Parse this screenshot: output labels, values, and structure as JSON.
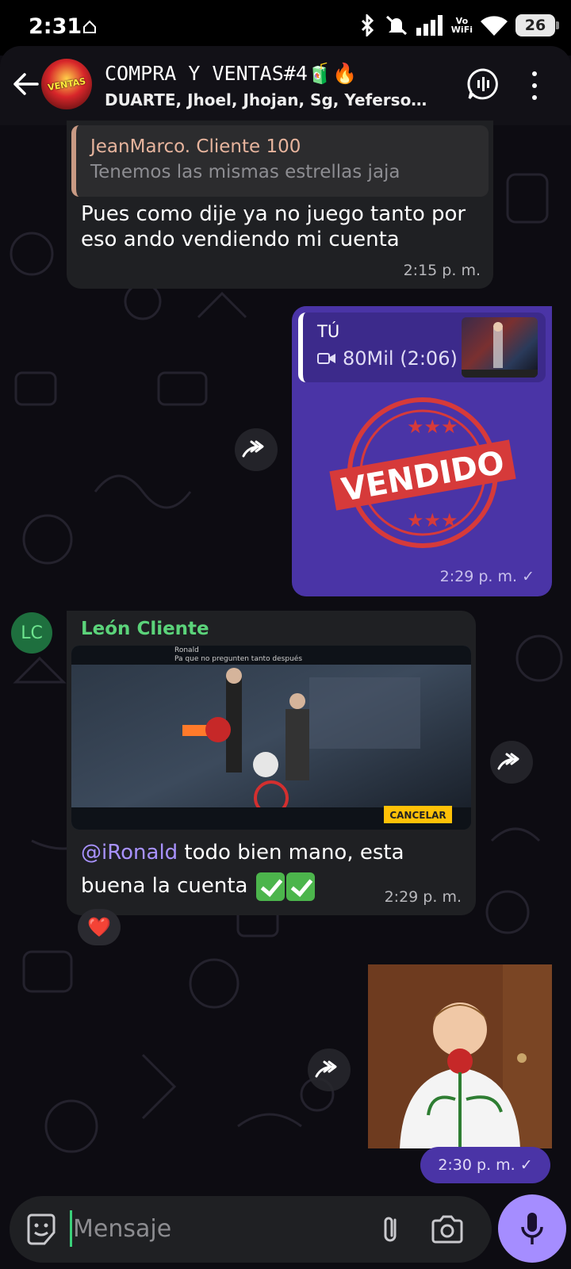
{
  "status_bar": {
    "time": "2:31",
    "network_label_top": "Vo",
    "network_label_bottom": "WiFi",
    "battery": "26"
  },
  "header": {
    "group_name": "COMPRA Y VENTAS#4🧃🔥",
    "members": "DUARTE, Jhoel, Jhojan, Sg, Yeferso…",
    "avatar_text": "VENTAS"
  },
  "messages": {
    "m1": {
      "quote_name": "JeanMarco. Cliente 100",
      "quote_text": "Tenemos las mismas estrellas jaja",
      "text": "Pues como dije ya no juego tanto por eso ando vendiendo mi cuenta",
      "time": "2:15 p. m."
    },
    "m2": {
      "quote_name": "TÚ",
      "quote_text": "80Mil (2:06)",
      "sticker_text": "VENDIDO",
      "time": "2:29 p. m. ✓"
    },
    "m3": {
      "avatar_initials": "LC",
      "sender": "León Cliente",
      "mention": "@iRonald",
      "text": " todo bien mano, esta buena la cuenta ",
      "time": "2:29 p. m.",
      "reaction": "❤️",
      "screenshot_user": "Ronald",
      "screenshot_note": "Pa que no pregunten tanto después",
      "screenshot_cancel": "CANCELAR"
    },
    "m4": {
      "time": "2:30 p. m. ✓"
    }
  },
  "composer": {
    "placeholder": "Mensaje"
  },
  "colors": {
    "outgoing_bubble": "#4a34a6",
    "incoming_bubble": "#1f2023",
    "sender_green": "#5bd37a",
    "mention_purple": "#a892ff",
    "mic_button": "#a58dff"
  },
  "icons": [
    "home-icon",
    "bluetooth-icon",
    "mute-icon",
    "signal-icon",
    "wifi-icon",
    "back-icon",
    "voice-chat-icon",
    "more-icon",
    "forward-icon",
    "video-icon",
    "sticker-icon",
    "attach-icon",
    "camera-icon",
    "mic-icon",
    "heart-icon"
  ]
}
